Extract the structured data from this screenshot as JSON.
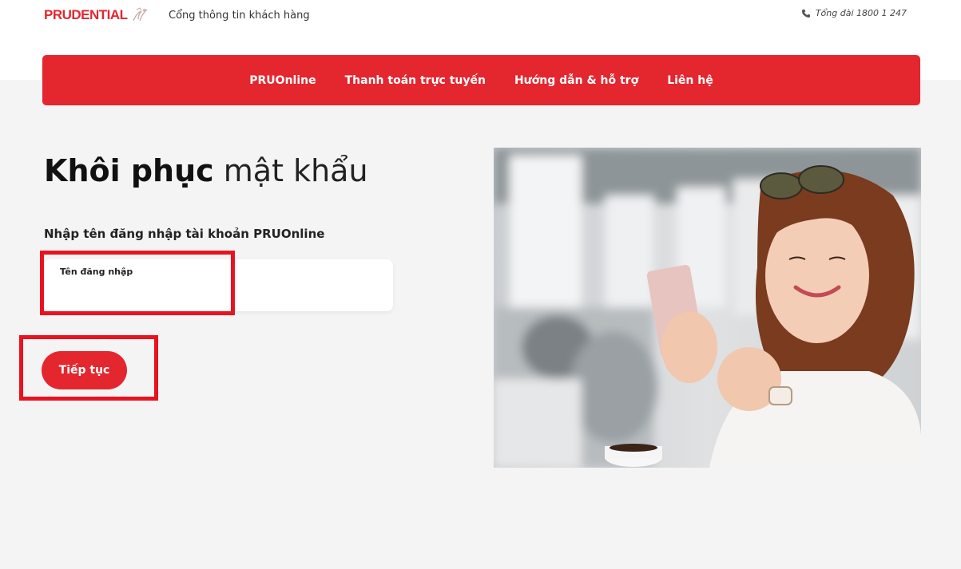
{
  "header": {
    "logo_text": "PRUDENTIAL",
    "portal_title": "Cổng thông tin khách hàng",
    "hotline": "Tổng đài 1800 1 247",
    "hotline_icon": "phone-icon"
  },
  "nav": {
    "items": [
      {
        "label": "PRUOnline"
      },
      {
        "label": "Thanh toán trực tuyến"
      },
      {
        "label": "Hướng dẫn & hỗ trợ"
      },
      {
        "label": "Liên hệ"
      }
    ]
  },
  "main": {
    "heading_bold": "Khôi phục",
    "heading_light": " mật khẩu",
    "instruction": "Nhập tên đăng nhập tài khoản PRUOnline",
    "username_label": "Tên đăng nhập",
    "username_value": "",
    "continue_label": "Tiếp tục"
  },
  "colors": {
    "brand_red": "#e4262f",
    "highlight_red": "#e8131f",
    "background_gray": "#f4f4f4"
  }
}
